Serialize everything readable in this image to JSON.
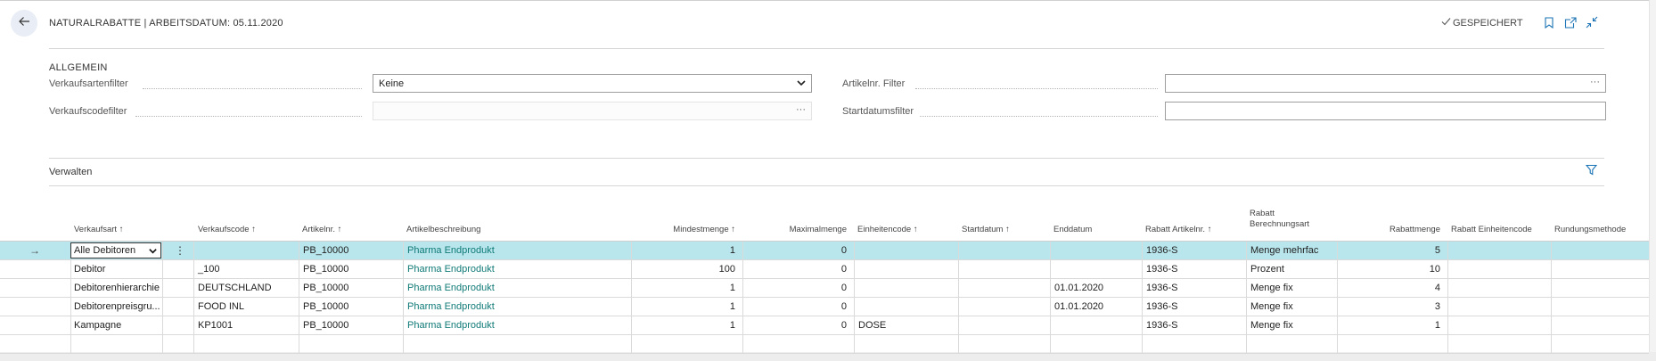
{
  "header": {
    "title": "NATURALRABATTE | ARBEITSDATUM: 05.11.2020",
    "saved_label": "GESPEICHERT",
    "icons": [
      "back-arrow-icon",
      "check-icon",
      "bookmark-icon",
      "open-new-window-icon",
      "collapse-icon"
    ]
  },
  "general": {
    "section_title": "ALLGEMEIN",
    "fields": {
      "verkaufsartenfilter": {
        "label": "Verkaufsartenfilter",
        "value": "Keine"
      },
      "verkaufscodefilter": {
        "label": "Verkaufscodefilter",
        "value": "",
        "ellipsis": "···"
      },
      "artikelnr_filter": {
        "label": "Artikelnr. Filter",
        "value": "",
        "ellipsis": "···"
      },
      "startdatumsfilter": {
        "label": "Startdatumsfilter",
        "value": ""
      }
    }
  },
  "manage": {
    "label": "Verwalten"
  },
  "grid": {
    "columns": [
      {
        "key": "verkaufsart",
        "label": "Verkaufsart ↑"
      },
      {
        "key": "verkaufscode",
        "label": "Verkaufscode ↑"
      },
      {
        "key": "artikelnr",
        "label": "Artikelnr. ↑"
      },
      {
        "key": "artikelbeschreibung",
        "label": "Artikelbeschreibung"
      },
      {
        "key": "mindestmenge",
        "label": "Mindestmenge ↑"
      },
      {
        "key": "maximalmenge",
        "label": "Maximalmenge"
      },
      {
        "key": "einheitencode",
        "label": "Einheitencode ↑"
      },
      {
        "key": "startdatum",
        "label": "Startdatum ↑"
      },
      {
        "key": "enddatum",
        "label": "Enddatum"
      },
      {
        "key": "rabatt_artikelnr",
        "label": "Rabatt Artikelnr. ↑"
      },
      {
        "key": "rabatt_berechnungsart",
        "label": "Rabatt\nBerechnungsart"
      },
      {
        "key": "rabattmenge",
        "label": "Rabattmenge"
      },
      {
        "key": "rabatt_einheitencode",
        "label": "Rabatt Einheitencode"
      },
      {
        "key": "rundungsmethode",
        "label": "Rundungsmethode"
      }
    ],
    "rows": [
      {
        "selected": true,
        "verkaufsart": "Alle Debitoren",
        "verkaufscode": "",
        "artikelnr": "PB_10000",
        "artikelbeschreibung": "Pharma Endprodukt",
        "mindestmenge": "1",
        "maximalmenge": "0",
        "einheitencode": "",
        "startdatum": "",
        "enddatum": "",
        "rabatt_artikelnr": "1936-S",
        "rabatt_berechnungsart": "Menge mehrfac",
        "rabattmenge": "5",
        "rabatt_einheitencode": "",
        "rundungsmethode": ""
      },
      {
        "selected": false,
        "verkaufsart": "Debitor",
        "verkaufscode": "_100",
        "artikelnr": "PB_10000",
        "artikelbeschreibung": "Pharma Endprodukt",
        "mindestmenge": "100",
        "maximalmenge": "0",
        "einheitencode": "",
        "startdatum": "",
        "enddatum": "",
        "rabatt_artikelnr": "1936-S",
        "rabatt_berechnungsart": "Prozent",
        "rabattmenge": "10",
        "rabatt_einheitencode": "",
        "rundungsmethode": ""
      },
      {
        "selected": false,
        "verkaufsart": "Debitorenhierarchie",
        "verkaufscode": "DEUTSCHLAND",
        "artikelnr": "PB_10000",
        "artikelbeschreibung": "Pharma Endprodukt",
        "mindestmenge": "1",
        "maximalmenge": "0",
        "einheitencode": "",
        "startdatum": "",
        "enddatum": "01.01.2020",
        "rabatt_artikelnr": "1936-S",
        "rabatt_berechnungsart": "Menge fix",
        "rabattmenge": "4",
        "rabatt_einheitencode": "",
        "rundungsmethode": ""
      },
      {
        "selected": false,
        "verkaufsart": "Debitorenpreisgru...",
        "verkaufscode": "FOOD INL",
        "artikelnr": "PB_10000",
        "artikelbeschreibung": "Pharma Endprodukt",
        "mindestmenge": "1",
        "maximalmenge": "0",
        "einheitencode": "",
        "startdatum": "",
        "enddatum": "01.01.2020",
        "rabatt_artikelnr": "1936-S",
        "rabatt_berechnungsart": "Menge fix",
        "rabattmenge": "3",
        "rabatt_einheitencode": "",
        "rundungsmethode": ""
      },
      {
        "selected": false,
        "verkaufsart": "Kampagne",
        "verkaufscode": "KP1001",
        "artikelnr": "PB_10000",
        "artikelbeschreibung": "Pharma Endprodukt",
        "mindestmenge": "1",
        "maximalmenge": "0",
        "einheitencode": "DOSE",
        "startdatum": "",
        "enddatum": "",
        "rabatt_artikelnr": "1936-S",
        "rabatt_berechnungsart": "Menge fix",
        "rabattmenge": "1",
        "rabatt_einheitencode": "",
        "rundungsmethode": ""
      },
      {
        "selected": false,
        "verkaufsart": "",
        "verkaufscode": "",
        "artikelnr": "",
        "artikelbeschreibung": "",
        "mindestmenge": "",
        "maximalmenge": "",
        "einheitencode": "",
        "startdatum": "",
        "enddatum": "",
        "rabatt_artikelnr": "",
        "rabatt_berechnungsart": "",
        "rabattmenge": "",
        "rabatt_einheitencode": "",
        "rundungsmethode": ""
      }
    ]
  },
  "colors": {
    "accent": "#0f7a77",
    "selected_row": "#b8e6ec",
    "icon_blue": "#1a73b5"
  }
}
